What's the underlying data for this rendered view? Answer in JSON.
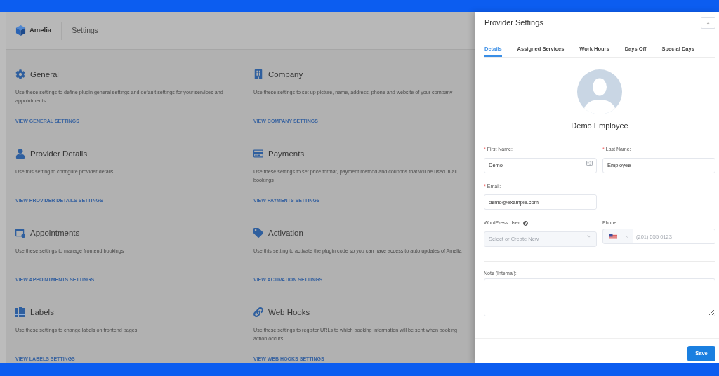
{
  "app_header": {
    "brand": "Amelia",
    "page_title": "Settings"
  },
  "settings_sections": [
    {
      "title": "General",
      "description": "Use these settings to define plugin general settings and default settings for your services and appointments",
      "link": "VIEW GENERAL SETTINGS"
    },
    {
      "title": "Company",
      "description": "Use these settings to set up picture, name, address, phone and website of your company",
      "link": "VIEW COMPANY SETTINGS"
    },
    {
      "title": "Provider Details",
      "description": "Use this setting to configure provider details",
      "link": "VIEW PROVIDER DETAILS SETTINGS"
    },
    {
      "title": "Payments",
      "description": "Use these settings to set price format, payment method and coupons that will be used in all bookings",
      "link": "VIEW PAYMENTS SETTINGS"
    },
    {
      "title": "Appointments",
      "description": "Use these settings to manage frontend bookings",
      "link": "VIEW APPOINTMENTS SETTINGS"
    },
    {
      "title": "Activation",
      "description": "Use this setting to activate the plugin code so you can have access to auto updates of Amelia",
      "link": "VIEW ACTIVATION SETTINGS"
    },
    {
      "title": "Labels",
      "description": "Use these settings to change labels on frontend pages",
      "link": "VIEW LABELS SETTINGS"
    },
    {
      "title": "Web Hooks",
      "description": "Use these settings to register URLs to which booking information will be sent when booking action occurs.",
      "link": "VIEW WEB HOOKS SETTINGS"
    }
  ],
  "drawer": {
    "title": "Provider Settings",
    "close_button": "×",
    "tabs": [
      {
        "label": "Details",
        "selected": true
      },
      {
        "label": "Assigned Services",
        "selected": false
      },
      {
        "label": "Work Hours",
        "selected": false
      },
      {
        "label": "Days Off",
        "selected": false
      },
      {
        "label": "Special Days",
        "selected": false
      }
    ],
    "employee_name": "Demo Employee",
    "first_name": {
      "required_mark": "*",
      "label": "First Name:",
      "value": "Demo"
    },
    "last_name": {
      "required_mark": "*",
      "label": "Last Name:",
      "value": "Employee"
    },
    "email": {
      "required_mark": "*",
      "label": "Email:",
      "value": "demo@example.com"
    },
    "wordpress_user": {
      "label": "WordPress User:",
      "placeholder": "Select or Create New",
      "disabled": true
    },
    "phone": {
      "label": "Phone:",
      "placeholder": "(201) 555 0123"
    },
    "note": {
      "label": "Note (Internal):"
    },
    "save_button": "Save"
  }
}
